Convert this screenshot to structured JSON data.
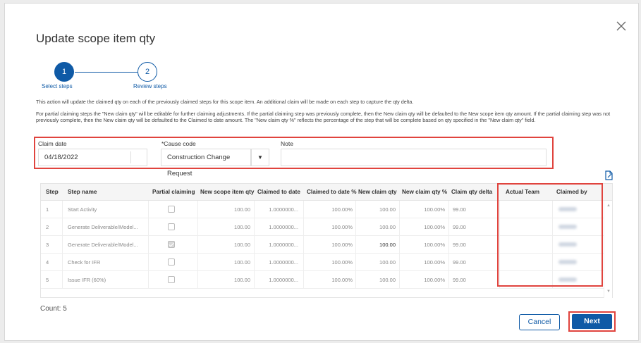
{
  "dialog": {
    "title": "Update scope item qty",
    "close_icon": "close-icon"
  },
  "stepper": {
    "steps": [
      {
        "number": "1",
        "label": "Select steps",
        "active": true
      },
      {
        "number": "2",
        "label": "Review steps",
        "active": false
      }
    ]
  },
  "info": {
    "line1": "This action will update the claimed qty on each of the previously claimed steps for this scope item. An additional claim will be made on each step to capture the qty delta.",
    "line2": "For partial claiming steps the \"New claim qty\" will be editable for further claiming adjustments. If the partial claiming step was previously complete, then the New claim qty will be defaulted to the New scope item qty amount. If the partial claiming step was not previously complete, then the New claim qty will be defaulted to the Claimed to date amount. The \"New claim qty %\" reflects the percentage of the step that will be complete based on qty specified in the \"New claim qty\" field."
  },
  "form": {
    "claim_date_label": "Claim date",
    "claim_date_value": "04/18/2022",
    "cause_code_label": "*Cause code",
    "cause_code_value": "Construction Change Request",
    "note_label": "Note",
    "note_value": ""
  },
  "table": {
    "columns": [
      "Step",
      "Step name",
      "Partial claiming",
      "New scope item qty",
      "Claimed to date",
      "Claimed to date %",
      "New claim qty",
      "New claim qty %",
      "Claim qty delta",
      "Actual Team",
      "Claimed by"
    ],
    "rows": [
      {
        "step": "1",
        "name": "Start Activity",
        "partial": false,
        "new_scope_qty": "100.00",
        "claimed_to_date": "1.0000000...",
        "claimed_pct": "100.00%",
        "new_claim_qty": "100.00",
        "new_claim_pct": "100.00%",
        "delta": "99.00",
        "actual_team": ""
      },
      {
        "step": "2",
        "name": "Generate Deliverable/Model...",
        "partial": false,
        "new_scope_qty": "100.00",
        "claimed_to_date": "1.0000000...",
        "claimed_pct": "100.00%",
        "new_claim_qty": "100.00",
        "new_claim_pct": "100.00%",
        "delta": "99.00",
        "actual_team": ""
      },
      {
        "step": "3",
        "name": "Generate Deliverable/Model...",
        "partial": true,
        "new_scope_qty": "100.00",
        "claimed_to_date": "1.0000000...",
        "claimed_pct": "100.00%",
        "new_claim_qty": "100.00",
        "new_claim_pct": "100.00%",
        "delta": "99.00",
        "actual_team": ""
      },
      {
        "step": "4",
        "name": "Check for IFR",
        "partial": false,
        "new_scope_qty": "100.00",
        "claimed_to_date": "1.0000000...",
        "claimed_pct": "100.00%",
        "new_claim_qty": "100.00",
        "new_claim_pct": "100.00%",
        "delta": "99.00",
        "actual_team": ""
      },
      {
        "step": "5",
        "name": "Issue IFR (60%)",
        "partial": false,
        "new_scope_qty": "100.00",
        "claimed_to_date": "1.0000000...",
        "claimed_pct": "100.00%",
        "new_claim_qty": "100.00",
        "new_claim_pct": "100.00%",
        "delta": "99.00",
        "actual_team": ""
      }
    ]
  },
  "footer": {
    "count": "Count: 5",
    "cancel_label": "Cancel",
    "next_label": "Next"
  },
  "colors": {
    "accent": "#0f5aa6",
    "highlight": "#e0443e"
  }
}
